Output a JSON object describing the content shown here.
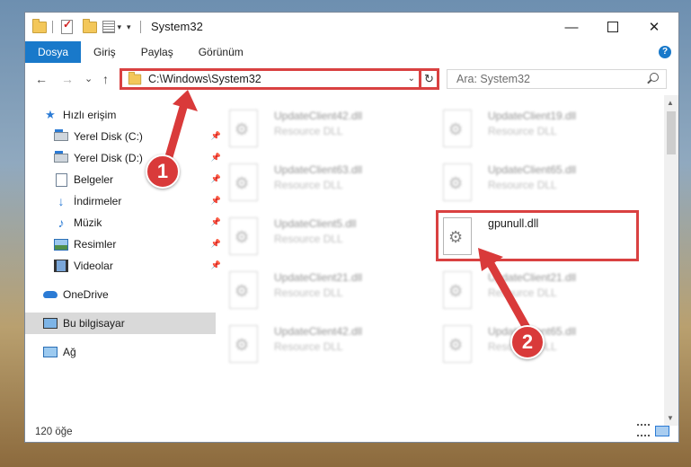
{
  "window": {
    "title": "System32",
    "minimize": "—",
    "close": "✕"
  },
  "ribbon": {
    "tabs": [
      {
        "label": "Dosya",
        "active": true
      },
      {
        "label": "Giriş"
      },
      {
        "label": "Paylaş"
      },
      {
        "label": "Görünüm"
      }
    ],
    "help": "?"
  },
  "nav": {
    "back": "←",
    "forward": "→",
    "recent": "⌄",
    "up": "↑",
    "address": "C:\\Windows\\System32",
    "refresh": "↻",
    "search_placeholder": "Ara: System32"
  },
  "sidebar": {
    "items": [
      {
        "label": "Hızlı erişim",
        "icon": "star-icon"
      },
      {
        "label": "Yerel Disk (C:)",
        "icon": "disk-icon",
        "pinned": true
      },
      {
        "label": "Yerel Disk (D:)",
        "icon": "disk-icon",
        "pinned": true
      },
      {
        "label": "Belgeler",
        "icon": "document-icon",
        "pinned": true
      },
      {
        "label": "İndirmeler",
        "icon": "download-icon",
        "pinned": true
      },
      {
        "label": "Müzik",
        "icon": "music-icon",
        "pinned": true
      },
      {
        "label": "Resimler",
        "icon": "pictures-icon",
        "pinned": true
      },
      {
        "label": "Videolar",
        "icon": "video-icon",
        "pinned": true
      },
      {
        "label": "OneDrive",
        "icon": "cloud-icon"
      },
      {
        "label": "Bu bilgisayar",
        "icon": "computer-icon",
        "selected": true
      },
      {
        "label": "Ağ",
        "icon": "network-icon"
      }
    ]
  },
  "files": [
    {
      "name": "UpdateClient42.dll",
      "desc": "Resource DLL"
    },
    {
      "name": "UpdateClient19.dll",
      "desc": "Resource DLL"
    },
    {
      "name": "UpdateClient63.dll",
      "desc": "Resource DLL"
    },
    {
      "name": "UpdateClient65.dll",
      "desc": "Resource DLL"
    },
    {
      "name": "UpdateClient5.dll",
      "desc": "Resource DLL"
    },
    {
      "name": "gpunull.dll",
      "desc": ""
    },
    {
      "name": "UpdateClient21.dll",
      "desc": "Resource DLL"
    },
    {
      "name": "UpdateClient21.dll",
      "desc": "Resource DLL"
    },
    {
      "name": "UpdateClient42.dll",
      "desc": "Resource DLL"
    },
    {
      "name": "UpdateClient65.dll",
      "desc": "Resource DLL"
    }
  ],
  "status": {
    "item_count": "120 öğe"
  },
  "annotations": {
    "step1": "1",
    "step2": "2",
    "color": "#d93a3a"
  }
}
